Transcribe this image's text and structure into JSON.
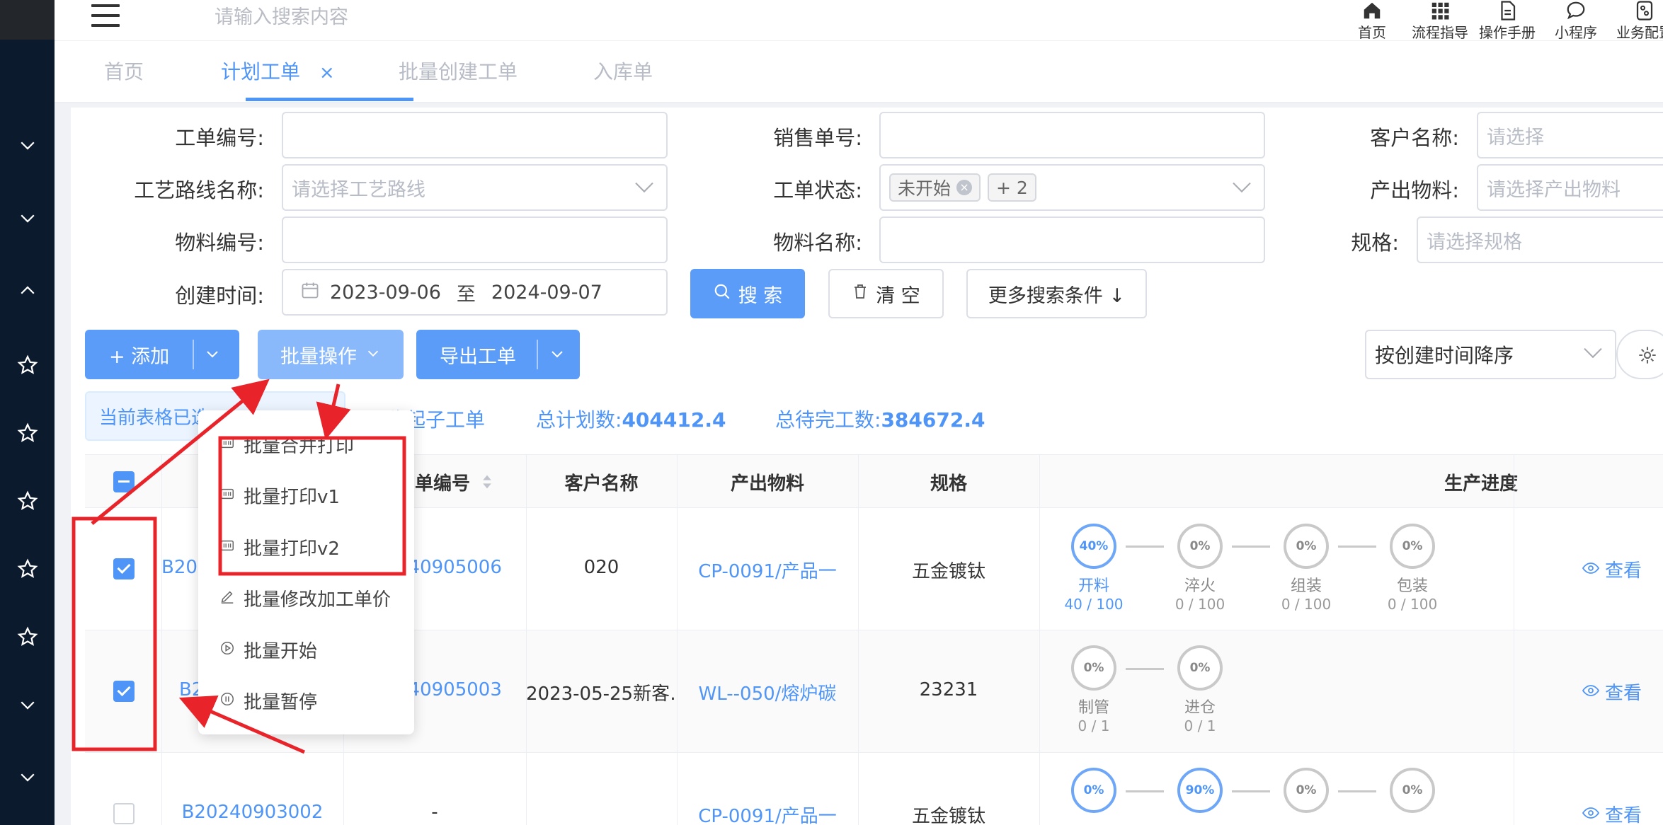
{
  "header": {
    "search_placeholder": "请输入搜索内容",
    "tools": [
      {
        "label": "首页",
        "icon": "home-icon"
      },
      {
        "label": "流程指导",
        "icon": "grid-icon"
      },
      {
        "label": "操作手册",
        "icon": "document-icon"
      },
      {
        "label": "小程序",
        "icon": "chat-bubble-icon"
      },
      {
        "label": "业务配置",
        "icon": "settings-panel-icon"
      }
    ]
  },
  "tabs": [
    {
      "label": "首页",
      "active": false
    },
    {
      "label": "计划工单",
      "active": true,
      "close": "×"
    },
    {
      "label": "批量创建工单",
      "active": false
    },
    {
      "label": "入库单",
      "active": false
    }
  ],
  "filters": {
    "work_order_no": {
      "label": "工单编号:",
      "value": ""
    },
    "sales_no": {
      "label": "销售单号:",
      "value": ""
    },
    "customer": {
      "label": "客户名称:",
      "placeholder": "请选择"
    },
    "route": {
      "label": "工艺路线名称:",
      "placeholder": "请选择工艺路线"
    },
    "status": {
      "label": "工单状态:",
      "tags": [
        "未开始",
        "+ 2"
      ]
    },
    "output_material": {
      "label": "产出物料:",
      "placeholder": "请选择产出物料"
    },
    "material_no": {
      "label": "物料编号:",
      "value": ""
    },
    "material_name": {
      "label": "物料名称:",
      "value": ""
    },
    "spec": {
      "label": "规格:",
      "placeholder": "请选择规格"
    },
    "created": {
      "label": "创建时间:",
      "start": "2023-09-06",
      "sep": "至",
      "end": "2024-09-07"
    }
  },
  "buttons": {
    "search": "搜 索",
    "clear": "清 空",
    "more": "更多搜索条件 ↓",
    "add": "+ 添加",
    "batch": "批量操作",
    "export": "导出工单",
    "sort": "按创建时间降序"
  },
  "info": {
    "selected_text": "当前表格已选",
    "collapse": "收起子工单",
    "plan_label": "总计划数:",
    "plan_value": "404412.4",
    "pending_label": "总待完工数:",
    "pending_value": "384672.4"
  },
  "table": {
    "headers": [
      "单编号",
      "客户名称",
      "产出物料",
      "规格",
      "生产进度"
    ],
    "view_label": "查看",
    "rows": [
      {
        "checked": true,
        "no_visible": "B20",
        "order": "240905006",
        "customer": "020",
        "material": "CP-0091/产品一",
        "spec": "五金镀钛",
        "steps": [
          {
            "pct": "40%",
            "name": "开料",
            "count": "40 / 100",
            "active": true
          },
          {
            "pct": "0%",
            "name": "淬火",
            "count": "0 / 100",
            "active": false
          },
          {
            "pct": "0%",
            "name": "组装",
            "count": "0 / 100",
            "active": false
          },
          {
            "pct": "0%",
            "name": "包装",
            "count": "0 / 100",
            "active": false
          }
        ]
      },
      {
        "checked": true,
        "no_visible": "B2",
        "order": "240905003",
        "customer": "2023-05-25新客…",
        "material": "WL--050/熔炉碳",
        "spec": "23231",
        "steps": [
          {
            "pct": "0%",
            "name": "制管",
            "count": "0 / 1",
            "active": false
          },
          {
            "pct": "0%",
            "name": "进仓",
            "count": "0 / 1",
            "active": false
          }
        ]
      },
      {
        "checked": false,
        "no_visible": "B20240903002",
        "order": "-",
        "customer": "",
        "material": "CP-0091/产品一",
        "spec": "五金镀钛",
        "steps": [
          {
            "pct": "0%",
            "name": "",
            "count": "",
            "active": true
          },
          {
            "pct": "90%",
            "name": "",
            "count": "",
            "active": true
          },
          {
            "pct": "0%",
            "name": "",
            "count": "",
            "active": false
          },
          {
            "pct": "0%",
            "name": "",
            "count": "",
            "active": false
          }
        ]
      }
    ]
  },
  "dropdown": {
    "items": [
      "批量合并打印",
      "批量打印v1",
      "批量打印v2",
      "批量修改加工单价",
      "批量开始",
      "批量暂停"
    ]
  },
  "annotation_color": "#e8242a",
  "accent_color": "#4f95f7"
}
